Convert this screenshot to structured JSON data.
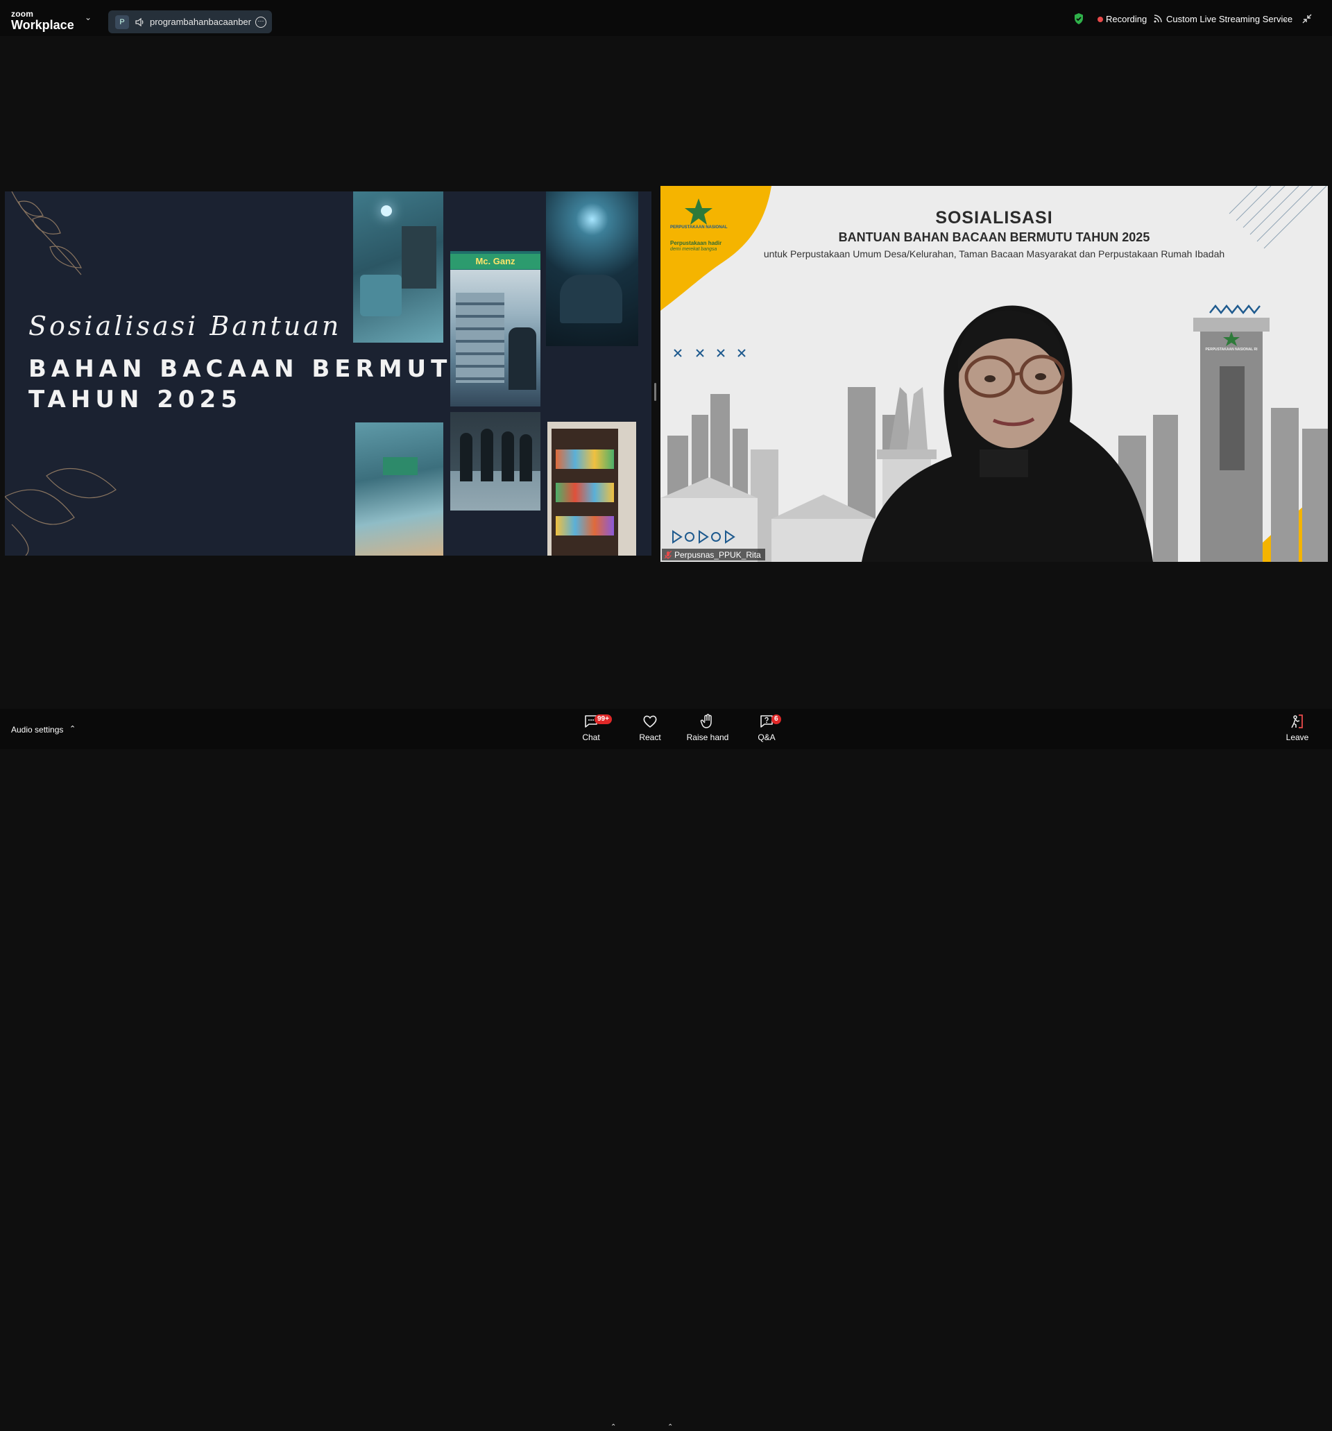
{
  "app": {
    "brand_small": "zoom",
    "brand_large": "Workplace"
  },
  "meeting": {
    "participant_initial": "P",
    "name": "programbahanbacaanbermu",
    "more_label": "⋯"
  },
  "status": {
    "recording_label": "Recording",
    "streaming_label": "Custom Live Streaming Service"
  },
  "share": {
    "title_line1": "Sosialisasi Bantuan",
    "title_line2": "BAHAN BACAAN BERMUTU",
    "title_line3": "TAHUN 2025",
    "photo_sign_text": "Mc. Ganz"
  },
  "video": {
    "heading": "SOSIALISASI",
    "subheading": "BANTUAN BAHAN BACAAN BERMUTU TAHUN 2025",
    "description": "untuk Perpustakaan Umum Desa/Kelurahan, Taman Bacaan Masyarakat dan Perpustakaan Rumah Ibadah",
    "logo_text1": "PERPUSTAKAAN NASIONAL",
    "logo_text2": "Perpustakaan hadir",
    "logo_text3": "demi merekat bangsa",
    "building_sign": "PERPUSTAKAAN NASIONAL RI",
    "participant_name": "Perpusnas_PPUK_Rita"
  },
  "toolbar": {
    "audio_settings": "Audio settings",
    "chat_label": "Chat",
    "chat_badge": "99+",
    "react_label": "React",
    "raise_hand_label": "Raise hand",
    "qa_label": "Q&A",
    "qa_badge": "6",
    "leave_label": "Leave"
  },
  "colors": {
    "accent_yellow": "#f5b400",
    "record_red": "#e84a4a",
    "shield_green": "#2fb14a"
  }
}
